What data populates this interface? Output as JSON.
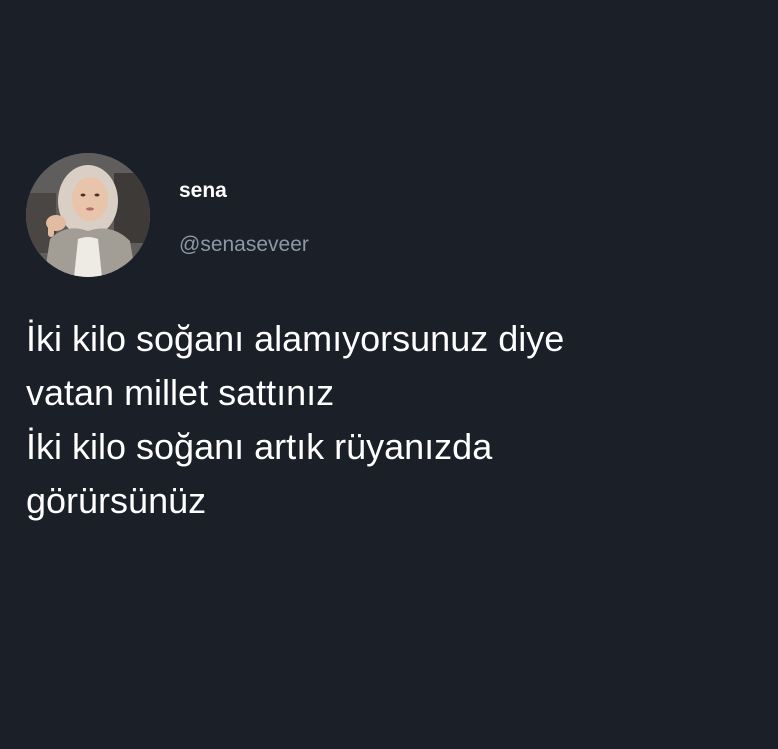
{
  "user": {
    "display_name": "sena",
    "handle": "@senaseveer",
    "avatar_icon": "profile-photo"
  },
  "tweet": {
    "lines": [
      "İki kilo soğanı alamıyorsunuz diye",
      "vatan millet sattınız",
      "İki kilo soğanı artık rüyanızda",
      "görürsünüz"
    ]
  },
  "colors": {
    "background": "#1a1f28",
    "text_primary": "#ffffff",
    "text_secondary": "#8b98a5"
  }
}
